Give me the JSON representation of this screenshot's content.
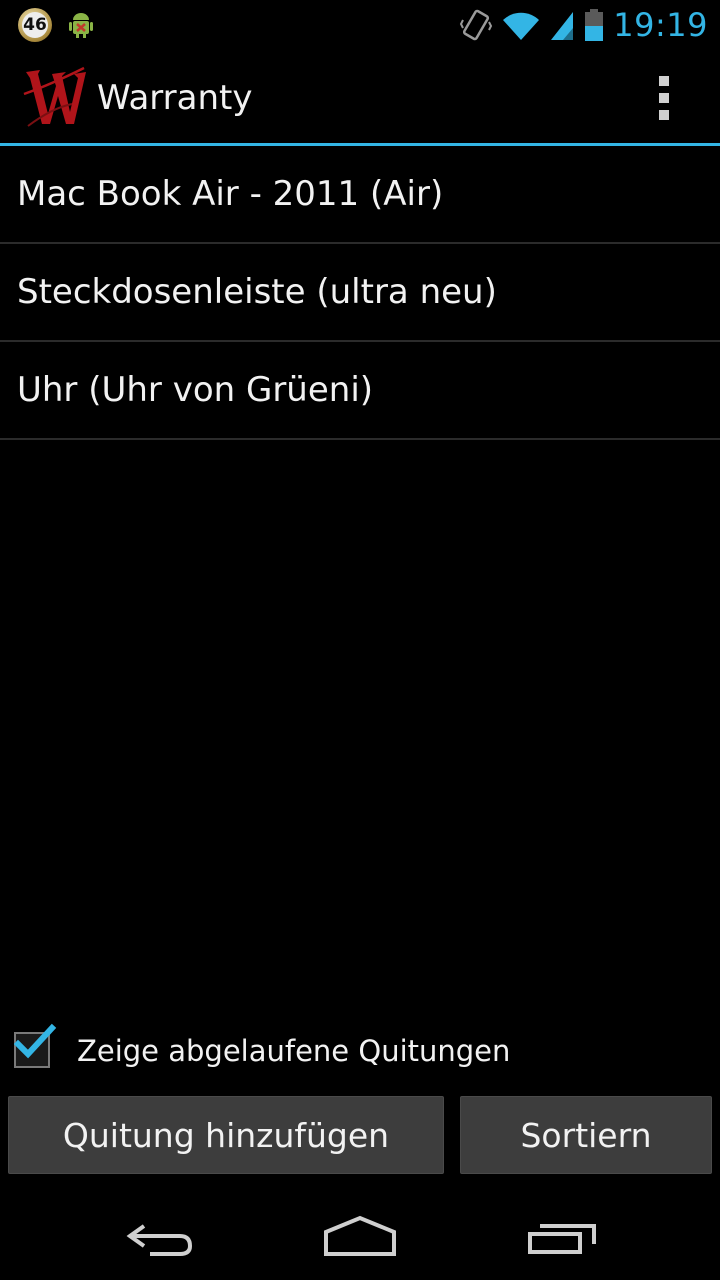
{
  "status_bar": {
    "notification_badge": "46",
    "time": "19:19",
    "icons": [
      "counter-badge-icon",
      "android-debug-icon",
      "vibrate-icon",
      "wifi-icon",
      "signal-icon",
      "battery-icon"
    ]
  },
  "action_bar": {
    "title": "Warranty",
    "logo": "W",
    "overflow_icon": "overflow-menu-icon"
  },
  "list": {
    "items": [
      {
        "label": "Mac Book Air - 2011 (Air)"
      },
      {
        "label": "Steckdosenleiste (ultra neu)"
      },
      {
        "label": "Uhr (Uhr von Grüeni)"
      }
    ]
  },
  "footer": {
    "checkbox_label": "Zeige abgelaufene Quitungen",
    "checkbox_checked": true,
    "add_button": "Quitung hinzufügen",
    "sort_button": "Sortiern"
  },
  "nav_bar": {
    "icons": [
      "back-icon",
      "home-icon",
      "recent-apps-icon"
    ]
  },
  "colors": {
    "accent": "#33b5e5",
    "background": "#000000",
    "button": "#3d3d3d",
    "logo": "#b0141a"
  }
}
